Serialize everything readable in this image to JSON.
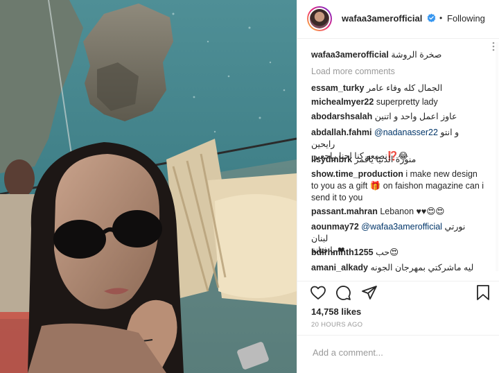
{
  "header": {
    "username": "wafaa3amerofficial",
    "separator": "•",
    "follow_status": "Following"
  },
  "caption": {
    "username": "wafaa3amerofficial",
    "text": "صخرة الروشة"
  },
  "load_more": "Load more comments",
  "comments": [
    {
      "user": "essam_turky",
      "text": "الجمال كله وفاء عامر"
    },
    {
      "user": "michealmyer22",
      "text": "superpretty lady"
    },
    {
      "user": "abodarshsalah",
      "text": "عاوز اعمل واحد و اتنين"
    },
    {
      "user": "abdallah.fahmi",
      "mention": "@nadanasser22",
      "text": "و انتو رايحين",
      "text2": "نصيعو كنا احنا راجعين⁉️😂"
    },
    {
      "user": "llsydmbrk",
      "text": "منورة الدنيا ياقمر"
    },
    {
      "user": "show.time_production",
      "text": "i make new design to you as a gift 🎁 on faishon magazine can i send it to you"
    },
    {
      "user": "passant.mahran",
      "text": "Lebanon ♥♥😍😍"
    },
    {
      "user": "aounmay72",
      "mention": "@wafaa3amerofficial",
      "text": "نورتي لبنان",
      "text2": "يا فنانة ❤"
    },
    {
      "user": "bdlrhmnth1255",
      "text": "حب😍"
    },
    {
      "user": "amani_alkady",
      "text": "ليه ماشركتي بمهرجان الجونه"
    }
  ],
  "likes": "14,758 likes",
  "timestamp": "20 HOURS AGO",
  "add_comment_placeholder": "Add a comment...",
  "icons": {
    "like": "heart-icon",
    "comment": "comment-icon",
    "share": "share-icon",
    "save": "bookmark-icon",
    "verified": "verified-badge-icon",
    "more": "more-options-icon"
  },
  "colors": {
    "text": "#262626",
    "muted": "#999999",
    "mention": "#003569",
    "verified": "#3897f0",
    "border": "#efefef"
  }
}
